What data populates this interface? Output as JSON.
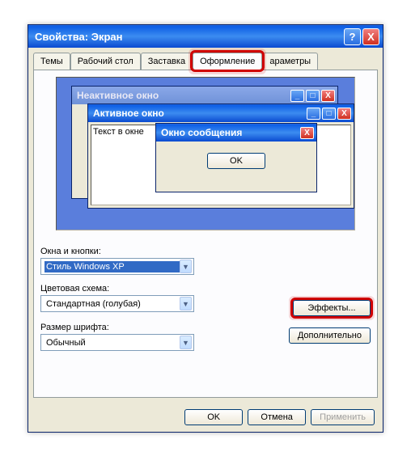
{
  "window": {
    "title": "Свойства: Экран"
  },
  "tabs": {
    "themes": "Темы",
    "desktop": "Рабочий стол",
    "screensaver": "Заставка",
    "appearance": "Оформление",
    "settings": "араметры"
  },
  "preview": {
    "inactive_title": "Неактивное окно",
    "active_title": "Активное окно",
    "sample_text": "Текст в окне",
    "msg_title": "Окно сообщения",
    "msg_ok": "OK"
  },
  "form": {
    "windows_buttons_label": "Окна и кнопки:",
    "windows_buttons_value": "Стиль Windows XP",
    "color_scheme_label": "Цветовая схема:",
    "color_scheme_value": "Стандартная (голубая)",
    "font_size_label": "Размер шрифта:",
    "font_size_value": "Обычный"
  },
  "buttons": {
    "effects": "Эффекты...",
    "advanced": "Дополнительно",
    "ok": "OK",
    "cancel": "Отмена",
    "apply": "Применить"
  },
  "icons": {
    "help": "?",
    "close": "X",
    "min": "_",
    "max": "□",
    "dropdown": "▼"
  }
}
